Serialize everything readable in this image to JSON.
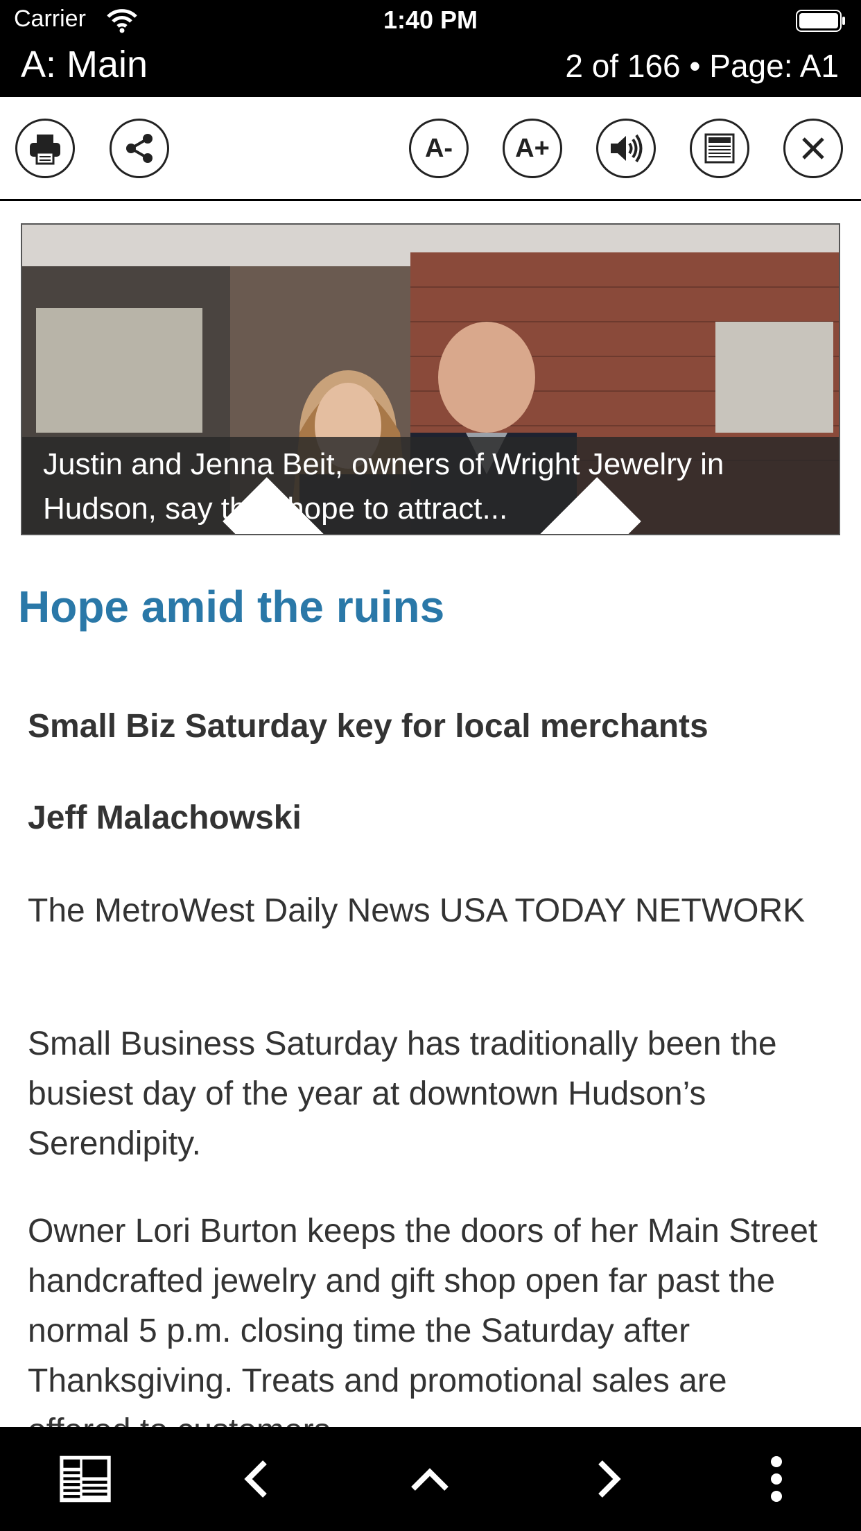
{
  "status_bar": {
    "carrier": "Carrier",
    "time": "1:40 PM",
    "section": "A: Main",
    "page_info": "2 of 166 • Page: A1"
  },
  "toolbar": {
    "font_decrease": "A-",
    "font_increase": "A+",
    "icons": [
      "printer-icon",
      "share-icon",
      "font-decrease-icon",
      "font-increase-icon",
      "speaker-icon",
      "newspaper-icon",
      "close-icon"
    ]
  },
  "photo": {
    "caption": "Justin and Jenna Beit, owners of Wright Jewelry in Hudson, say they hope to attract..."
  },
  "article": {
    "headline": "Hope amid the ruins",
    "subheadline": "Small Biz Saturday key for local merchants",
    "author": "Jeff Malachowski",
    "source": "The MetroWest Daily News USA TODAY NETWORK",
    "paragraphs": [
      "Small Business Saturday has traditionally been the busiest day of the year at downtown Hudson’s Serendipity.",
      "Owner Lori Burton keeps the doors of her Main Street handcrafted jewelry and gift shop open far past the normal 5 p.m. closing time the Saturday after Thanksgiving. Treats and promotional sales are offered to customers"
    ]
  },
  "bottom_bar": {
    "icons": [
      "newspaper-icon",
      "chevron-left-icon",
      "chevron-up-icon",
      "chevron-right-icon",
      "more-vertical-icon"
    ]
  },
  "colors": {
    "headline": "#2a78a8",
    "bars": "#000000"
  }
}
